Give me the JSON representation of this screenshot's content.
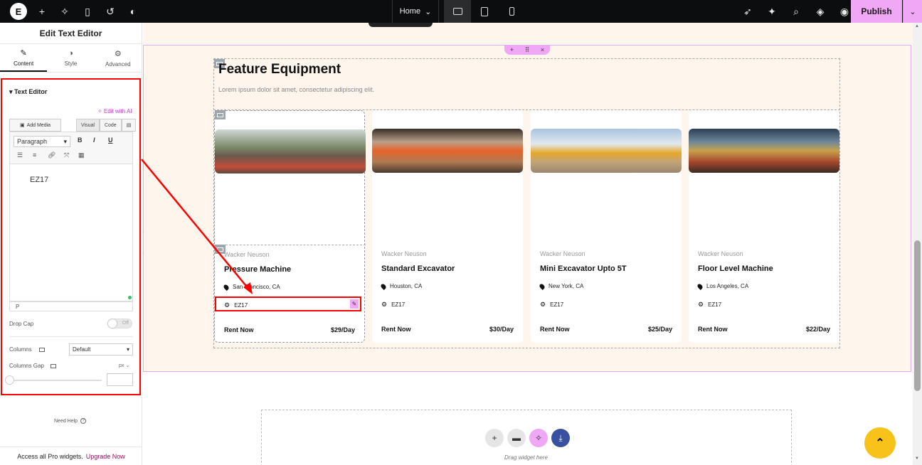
{
  "topbar": {
    "logo": "E",
    "page_selector": "Home",
    "publish_label": "Publish"
  },
  "panel": {
    "title": "Edit Text Editor",
    "tabs": [
      {
        "label": "Content",
        "icon": "pencil-icon"
      },
      {
        "label": "Style",
        "icon": "half-circle-icon"
      },
      {
        "label": "Advanced",
        "icon": "gear-icon"
      }
    ],
    "section_title": "Text Editor",
    "edit_ai": "Edit with AI",
    "add_media": "Add Media",
    "mode_visual": "Visual",
    "mode_code": "Code",
    "format_select": "Paragraph",
    "fmt_bold": "B",
    "fmt_italic": "I",
    "fmt_underline": "U",
    "editor_text": "EZ17",
    "editor_footer": "P",
    "drop_cap_label": "Drop Cap",
    "drop_cap_state": "Off",
    "columns_label": "Columns",
    "columns_value": "Default",
    "columns_gap_label": "Columns Gap",
    "columns_gap_unit": "px",
    "need_help": "Need Help",
    "upgrade_text": "Access all Pro widgets.",
    "upgrade_link": "Upgrade Now"
  },
  "canvas": {
    "heading": "Feature Equipment",
    "subheading": "Lorem ipsum dolor sit amet, consectetur adipiscing elit.",
    "cards": [
      {
        "brand": "Wacker Neuson",
        "title": "Pressure Machine",
        "location": "San Francisco, CA",
        "code": "EZ17",
        "rent": "Rent Now",
        "price": "$29/Day"
      },
      {
        "brand": "Wacker Neuson",
        "title": "Standard Excavator",
        "location": "Houston, CA",
        "code": "EZ17",
        "rent": "Rent Now",
        "price": "$30/Day"
      },
      {
        "brand": "Wacker Neuson",
        "title": "Mini Excavator Upto 5T",
        "location": "New York, CA",
        "code": "EZ17",
        "rent": "Rent Now",
        "price": "$25/Day"
      },
      {
        "brand": "Wacker Neuson",
        "title": "Floor Level Machine",
        "location": "Los Angeles, CA",
        "code": "EZ17",
        "rent": "Rent Now",
        "price": "$22/Day"
      }
    ],
    "drop_zone_text": "Drag widget here"
  },
  "colors": {
    "accent_pink": "#f0a7f6",
    "annotation_red": "#ff0000",
    "section_bg": "#fef6ec",
    "scroll_top": "#f7c21a"
  }
}
